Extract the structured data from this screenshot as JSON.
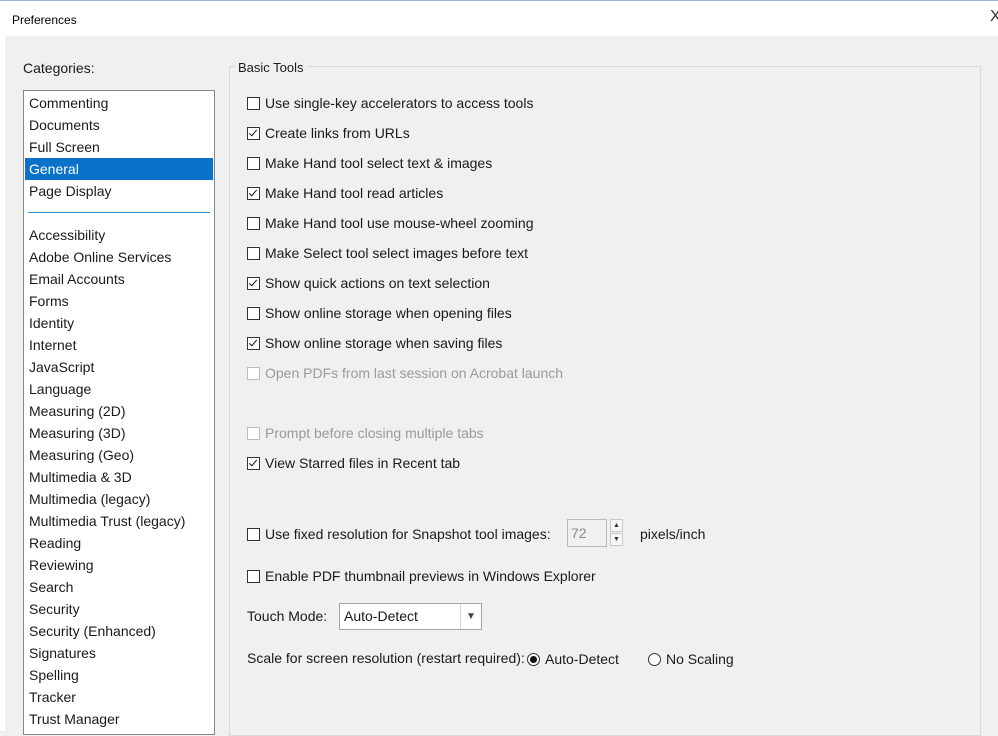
{
  "window": {
    "title": "Preferences",
    "close_glyph": "X"
  },
  "categories": {
    "label": "Categories:",
    "top_items": [
      "Commenting",
      "Documents",
      "Full Screen",
      "General",
      "Page Display"
    ],
    "selected": "General",
    "items": [
      "Accessibility",
      "Adobe Online Services",
      "Email Accounts",
      "Forms",
      "Identity",
      "Internet",
      "JavaScript",
      "Language",
      "Measuring (2D)",
      "Measuring (3D)",
      "Measuring (Geo)",
      "Multimedia & 3D",
      "Multimedia (legacy)",
      "Multimedia Trust (legacy)",
      "Reading",
      "Reviewing",
      "Search",
      "Security",
      "Security (Enhanced)",
      "Signatures",
      "Spelling",
      "Tracker",
      "Trust Manager"
    ]
  },
  "basic_tools": {
    "title": "Basic Tools",
    "options": [
      {
        "label": "Use single-key accelerators to access tools",
        "checked": false,
        "enabled": true
      },
      {
        "label": "Create links from URLs",
        "checked": true,
        "enabled": true
      },
      {
        "label": "Make Hand tool select text & images",
        "checked": false,
        "enabled": true
      },
      {
        "label": "Make Hand tool read articles",
        "checked": true,
        "enabled": true
      },
      {
        "label": "Make Hand tool use mouse-wheel zooming",
        "checked": false,
        "enabled": true
      },
      {
        "label": "Make Select tool select images before text",
        "checked": false,
        "enabled": true
      },
      {
        "label": "Show quick actions on text selection",
        "checked": true,
        "enabled": true
      },
      {
        "label": "Show online storage when opening files",
        "checked": false,
        "enabled": true
      },
      {
        "label": "Show online storage when saving files",
        "checked": true,
        "enabled": true
      },
      {
        "label": "Open PDFs from last session on Acrobat launch",
        "checked": false,
        "enabled": false
      },
      {
        "label": "Prompt before closing multiple tabs",
        "checked": false,
        "enabled": false
      },
      {
        "label": "View Starred files in Recent tab",
        "checked": true,
        "enabled": true
      },
      {
        "label": "Use fixed resolution for Snapshot tool images:",
        "checked": false,
        "enabled": true
      },
      {
        "label": "Enable PDF thumbnail previews in Windows Explorer",
        "checked": false,
        "enabled": true
      }
    ],
    "snapshot": {
      "value": "72",
      "unit": "pixels/inch"
    },
    "touch_mode": {
      "label": "Touch Mode:",
      "value": "Auto-Detect"
    },
    "scale": {
      "label": "Scale for screen resolution (restart required):",
      "options": [
        "Auto-Detect",
        "No Scaling"
      ],
      "selected": "Auto-Detect"
    }
  }
}
